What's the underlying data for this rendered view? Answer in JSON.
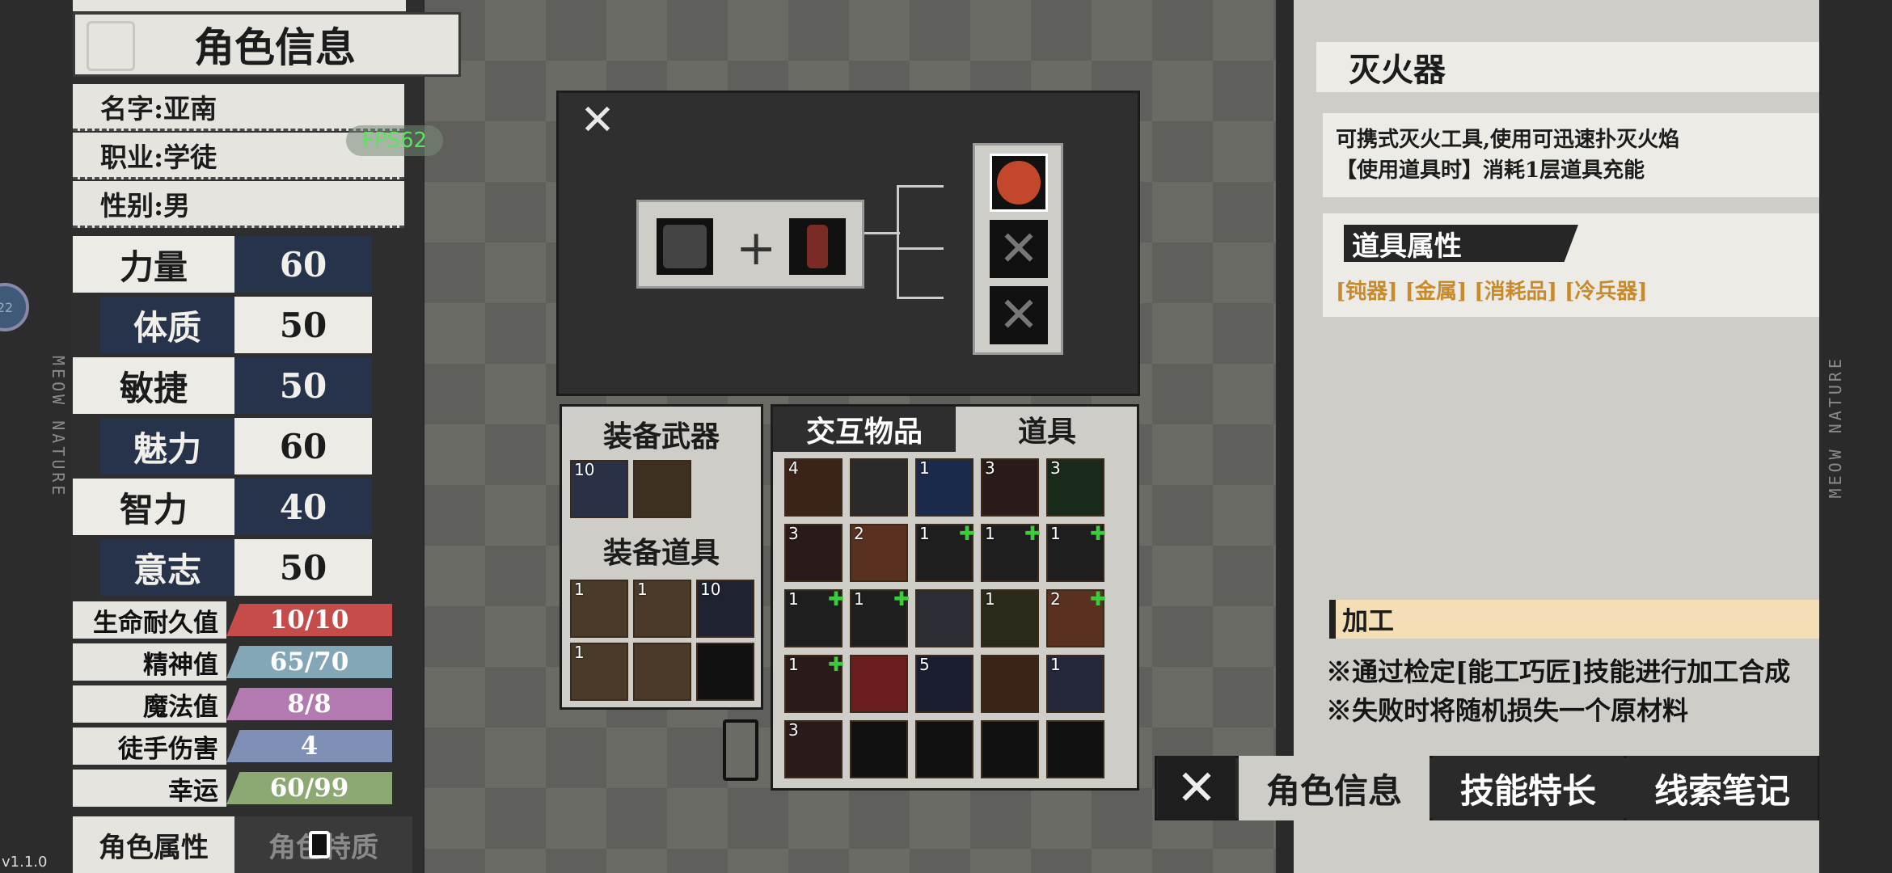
{
  "character": {
    "title": "角色信息",
    "name": "名字:亚南",
    "job": "职业:学徒",
    "gender": "性别:男",
    "stats": [
      {
        "name": "力量",
        "value": "60"
      },
      {
        "name": "体质",
        "value": "50"
      },
      {
        "name": "敏捷",
        "value": "50"
      },
      {
        "name": "魅力",
        "value": "60"
      },
      {
        "name": "智力",
        "value": "40"
      },
      {
        "name": "意志",
        "value": "50"
      }
    ],
    "bars": [
      {
        "label": "生命耐久值",
        "value": "10/10",
        "color": "#c64b4b"
      },
      {
        "label": "精神值",
        "value": "65/70",
        "color": "#84a7b8"
      },
      {
        "label": "魔法值",
        "value": "8/8",
        "color": "#b37ab1"
      },
      {
        "label": "徒手伤害",
        "value": "4",
        "color": "#7f8fb5"
      },
      {
        "label": "幸运",
        "value": "60/99",
        "color": "#8ca973"
      }
    ],
    "tab_attributes": "角色属性",
    "tab_traits": "角色特质"
  },
  "fps": "FPS62",
  "circle_badge": "22",
  "version": "v1.1.0",
  "side_text_left": "MEOW NATURE",
  "side_text_right": "MEOW NATURE",
  "equip": {
    "weapons_title": "装备武器",
    "items_title": "装备道具",
    "weapon_counts": [
      "10",
      ""
    ],
    "item_counts": [
      "1",
      "1",
      "10",
      "1",
      "",
      ""
    ]
  },
  "inventory": {
    "tab_interact": "交互物品",
    "tab_items": "道具",
    "counts": [
      "4",
      "",
      "1",
      "3",
      "3",
      "3",
      "2",
      "1",
      "1",
      "1",
      "1",
      "1",
      "",
      "1",
      "2",
      "1",
      "",
      "5",
      "",
      "1",
      "3",
      "",
      "",
      "",
      ""
    ]
  },
  "detail": {
    "item_name": "灭火器",
    "desc_line1": "可携式灭火工具,使用可迅速扑灭火焰",
    "desc_line2": "【使用道具时】消耗1层道具充能",
    "props_title": "道具属性",
    "tags": "[钝器] [金属] [消耗品] [冷兵器]",
    "process_title": "加工",
    "note1": "※通过检定[能工巧匠]技能进行加工合成",
    "note2": "※失败时将随机损失一个原材料"
  },
  "bottom_tabs": {
    "character": "角色信息",
    "skills": "技能特长",
    "clues": "线索笔记"
  },
  "colors": {
    "stat_dark": "#26334a",
    "accent_orange": "#c88a2a"
  }
}
